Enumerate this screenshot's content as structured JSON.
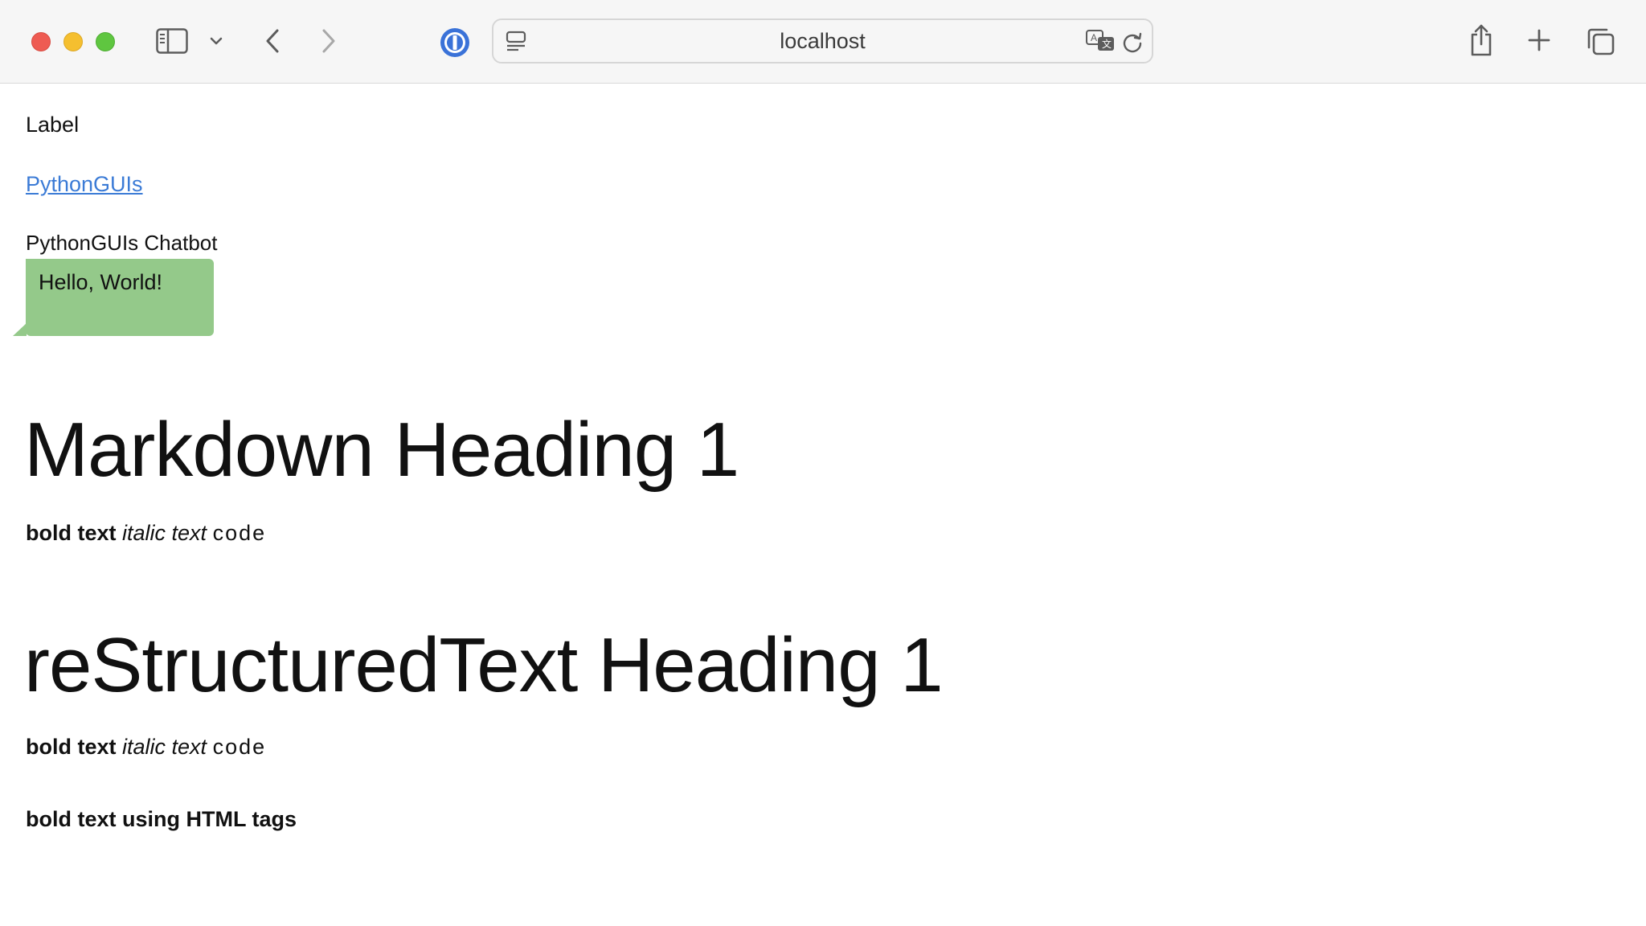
{
  "browser": {
    "address": "localhost",
    "icons": {
      "sidebar": "sidebar-icon",
      "sidebar_menu": "chevron-down-icon",
      "back": "back-arrow-icon",
      "forward": "forward-arrow-icon",
      "password_manager": "password-manager-icon",
      "reader": "reader-mode-icon",
      "translate": "translate-icon",
      "reload": "reload-icon",
      "share": "share-icon",
      "new_tab": "plus-icon",
      "tabs": "tab-overview-icon"
    },
    "traffic_colors": {
      "close": "#ee5b52",
      "minimize": "#f5bf2f",
      "maximize": "#5fc640"
    }
  },
  "page": {
    "label": "Label",
    "link": "PythonGUIs",
    "chatbot": {
      "title": "PythonGUIs Chatbot",
      "message": "Hello, World!",
      "bubble_color": "#94c98a"
    },
    "markdown": {
      "heading": "Markdown Heading 1",
      "bold": "bold text",
      "italic": "italic text",
      "code": "code"
    },
    "rst": {
      "heading": "reStructuredText Heading 1",
      "bold": "bold text",
      "italic": "italic text",
      "code": "code"
    },
    "html_bold": "bold text using HTML tags",
    "link_color": "#3b7bd6"
  }
}
